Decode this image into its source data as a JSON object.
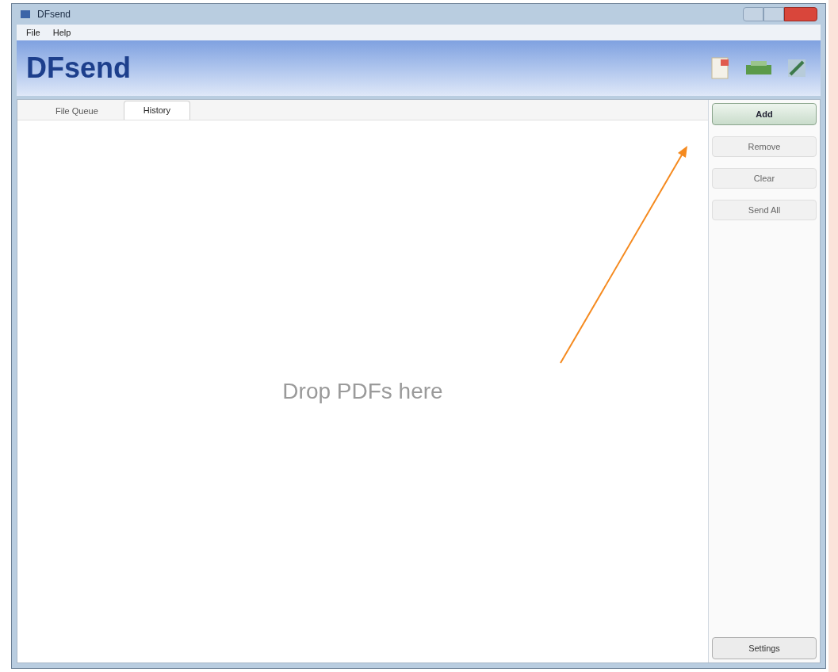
{
  "window": {
    "title": "DFsend"
  },
  "menu": [
    "File",
    "Help"
  ],
  "header": {
    "logo": "DFsend"
  },
  "tabs": [
    {
      "label": "File Queue",
      "selected": false
    },
    {
      "label": "History",
      "selected": true
    }
  ],
  "drop_hint": "Drop PDFs here",
  "buttons": [
    {
      "label": "Add",
      "kind": "primary"
    },
    {
      "label": "Remove",
      "kind": "plain"
    },
    {
      "label": "Clear",
      "kind": "plain"
    },
    {
      "label": "Send All",
      "kind": "plain"
    }
  ],
  "bottom_button": "Settings"
}
